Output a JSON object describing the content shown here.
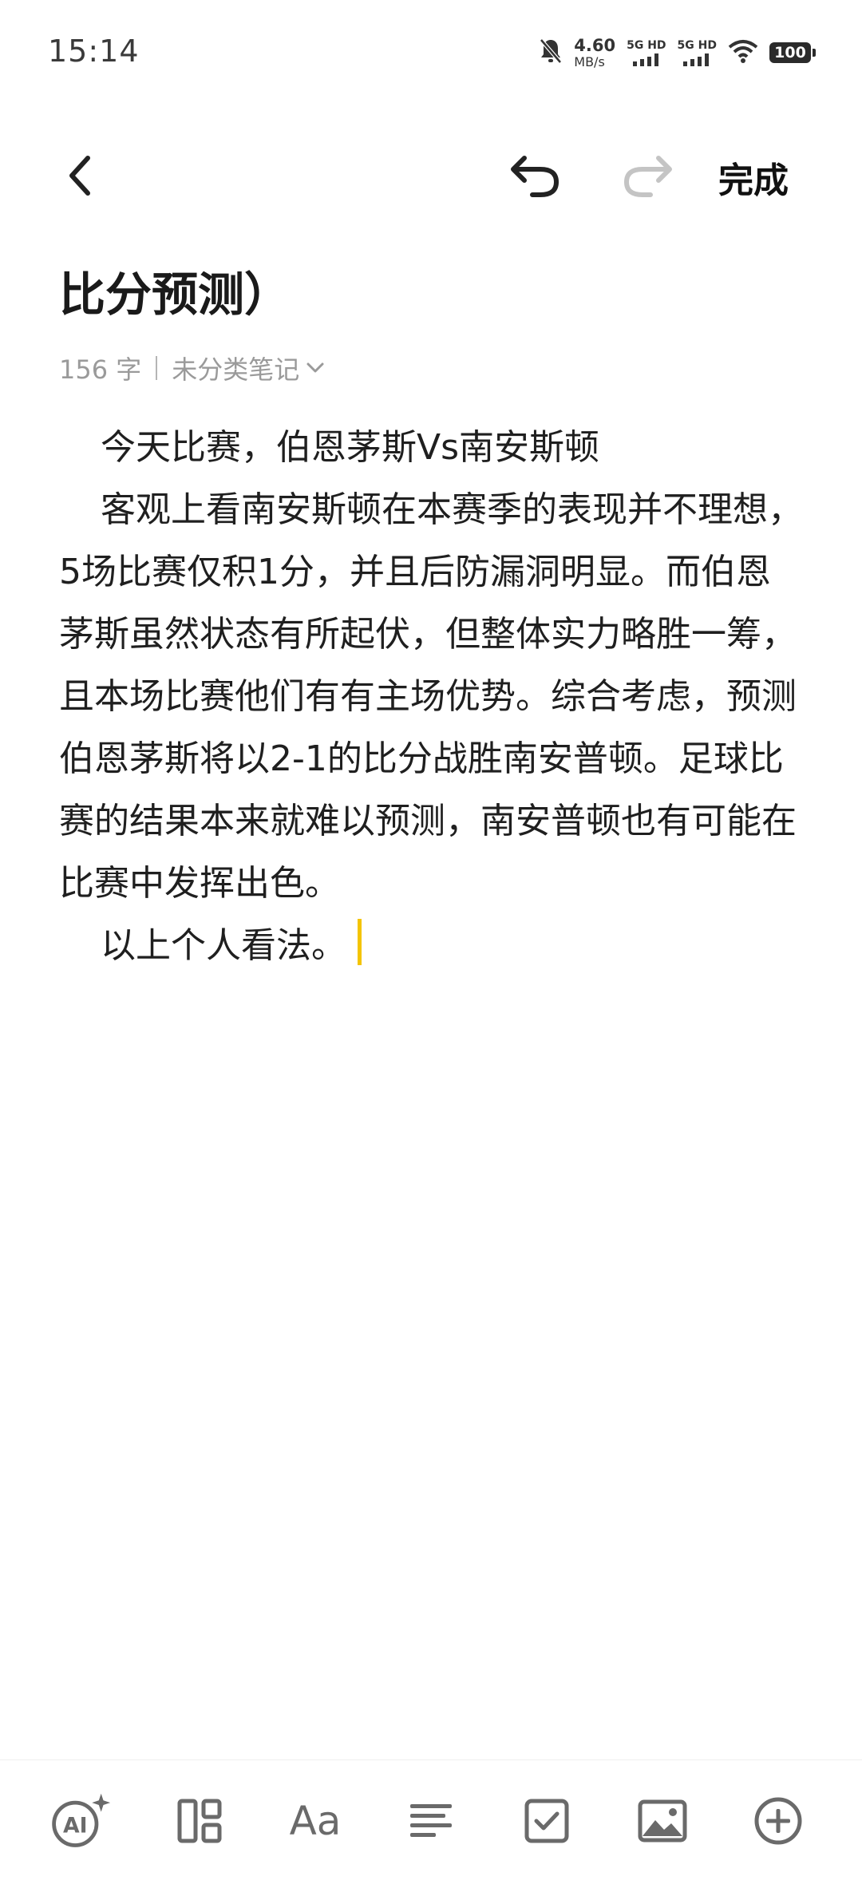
{
  "status_bar": {
    "time": "15:14",
    "net_speed": "4.60",
    "net_unit": "MB/s",
    "signal1_label": "5G HD",
    "signal2_label": "5G HD",
    "battery": "100"
  },
  "toolbar_top": {
    "done_label": "完成"
  },
  "note": {
    "title": "比分预测）",
    "word_count": "156 字",
    "category": "未分类笔记",
    "paragraphs": [
      "今天比赛，伯恩茅斯Vs南安斯顿",
      "客观上看南安斯顿在本赛季的表现并不理想，5场比赛仅积1分，并且后防漏洞明显。而伯恩茅斯虽然状态有所起伏，但整体实力略胜一筹，且本场比赛他们有有主场优势。综合考虑，预测伯恩茅斯将以2-1的比分战胜南安普顿。足球比赛的结果本来就难以预测，南安普顿也有可能在比赛中发挥出色。",
      "以上个人看法。"
    ]
  },
  "bottom_toolbar": {
    "ai_label": "AI",
    "text_format_label": "Aa"
  },
  "colors": {
    "cursor": "#f4c400",
    "text": "#1f1f1f",
    "meta": "#9a9a9a"
  }
}
